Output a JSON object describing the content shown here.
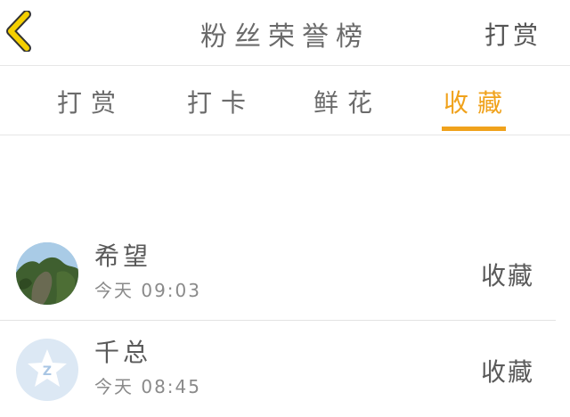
{
  "header": {
    "title": "粉丝荣誉榜",
    "reward_label": "打赏"
  },
  "tabs": [
    {
      "label": "打赏",
      "active": false
    },
    {
      "label": "打卡",
      "active": false
    },
    {
      "label": "鲜花",
      "active": false
    },
    {
      "label": "收藏",
      "active": true
    }
  ],
  "list": [
    {
      "name": "希望",
      "time": "今天 09:03",
      "action": "收藏",
      "avatar": "landscape-photo"
    },
    {
      "name": "千总",
      "time": "今天 08:45",
      "action": "收藏",
      "avatar": "qq-default-avatar"
    }
  ],
  "colors": {
    "accent": "#f0a21c",
    "back_icon": "#f5d000",
    "text": "#555555"
  }
}
